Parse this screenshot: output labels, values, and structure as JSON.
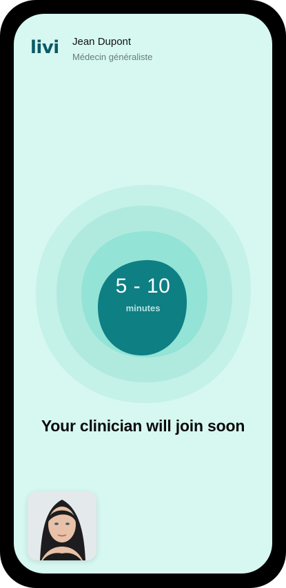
{
  "app": {
    "logo": "livi"
  },
  "clinician": {
    "name": "Jean Dupont",
    "role": "Médecin généraliste"
  },
  "wait": {
    "value": "5 - 10",
    "unit": "minutes"
  },
  "headline": "Your clinician will join soon",
  "colors": {
    "background": "#d6f8f1",
    "ring_outer": "#c4f1e8",
    "ring_middle": "#b0eadf",
    "ring_inner": "#93e3d6",
    "core": "#0e7f83",
    "brand": "#0b5a66"
  },
  "icons": {
    "self_view": "camera-self-view"
  }
}
